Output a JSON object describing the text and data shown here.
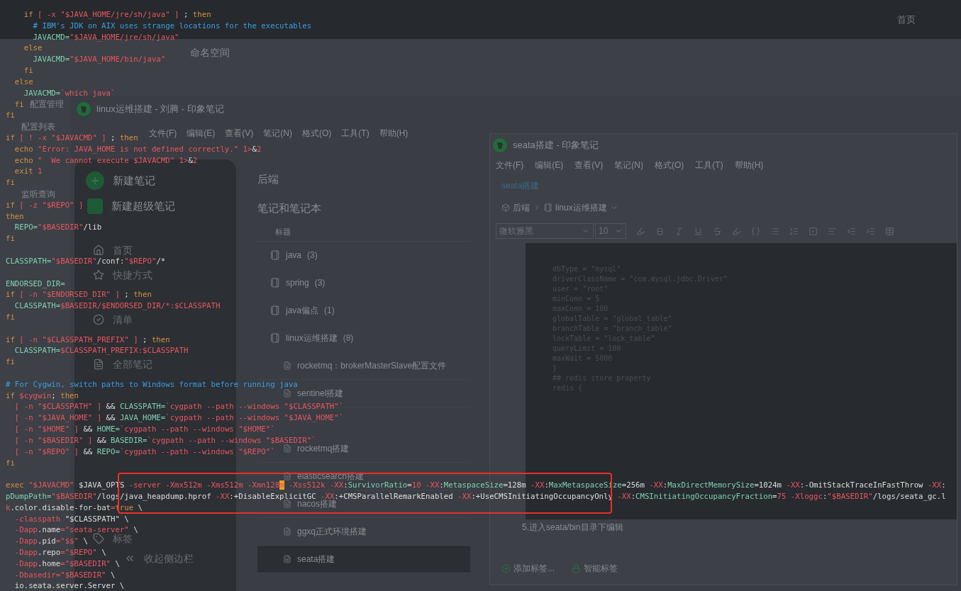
{
  "nacos": {
    "top_link": "首页",
    "namespace": "命名空间",
    "sidebar": [
      "配置管理",
      "配置列表",
      "监听查询"
    ]
  },
  "notes_window": {
    "title": "linux运维搭建 - 刘腾 - 印象笔记",
    "menu": [
      "文件(F)",
      "编辑(E)",
      "查看(V)",
      "笔记(N)",
      "格式(O)",
      "工具(T)",
      "帮助(H)"
    ],
    "actions": [
      {
        "kind": "note",
        "label": "新建笔记"
      },
      {
        "kind": "super",
        "label": "新建超级笔记"
      }
    ],
    "nav": [
      {
        "kind": "home",
        "label": "首页"
      },
      {
        "kind": "star",
        "label": "快捷方式"
      },
      {
        "kind": "check",
        "label": "清单"
      },
      {
        "kind": "notes",
        "label": "全部笔记"
      },
      {
        "kind": "tag",
        "label": "标签"
      },
      {
        "kind": "collapse",
        "label": "收起侧边栏"
      }
    ],
    "space": "后端",
    "section": "笔记和笔记本",
    "column": "标题",
    "notebooks": [
      {
        "name": "java",
        "count": "(3)"
      },
      {
        "name": "spring",
        "count": "(3)"
      },
      {
        "name": "java偏点",
        "count": "(1)"
      },
      {
        "name": "linux运维搭建",
        "count": "(8)",
        "children": [
          {
            "title": "rocketmq：brokerMasterSlave配置文件",
            "selected": false
          },
          {
            "title": "sentinel搭建",
            "selected": false
          },
          {
            "title": "rocketmq搭建",
            "selected": false
          },
          {
            "title": "elasticsearch搭建",
            "selected": false
          },
          {
            "title": "nacos搭建",
            "selected": false
          },
          {
            "title": "ggxq正式环境搭建",
            "selected": false
          },
          {
            "title": "seata搭建",
            "selected": true
          }
        ]
      }
    ]
  },
  "note_window": {
    "title": "seata搭建 - 印象笔记",
    "menu": [
      "文件(F)",
      "编辑(E)",
      "查看(V)",
      "笔记(N)",
      "格式(O)",
      "工具(T)",
      "帮助(H)"
    ],
    "note_link": "seata搭建",
    "breadcrumb": [
      "后端",
      "linux运维搭建"
    ],
    "font": "微软雅黑",
    "size": "10",
    "code": [
      "dbType = \"mysql\"",
      "driverClassName = \"com.mysql.jdbc.Driver\"",
      "user = \"root\"",
      "minConn = 5",
      "maxConn = 100",
      "globalTable = \"global_table\"",
      "branchTable = \"branch_table\"",
      "lockTable = \"lock_table\"",
      "queryLimit = 100",
      "maxWait = 5000",
      "}",
      "## redis store property",
      "redis {"
    ],
    "step": "5.进入seata/bin目录下编辑",
    "tag_buttons": [
      {
        "kind": "add",
        "label": "添加标签..."
      },
      {
        "kind": "smart",
        "label": "智能标签"
      }
    ]
  },
  "terminal": {
    "lines": [
      {
        "tokens": [
          {
            "kind": "k",
            "text": "    if"
          },
          {
            "kind": "s",
            "text": " [ -x \"$JAVA_HOME/jre/sh/java\" ]"
          },
          {
            "kind": "p",
            "text": " ; "
          },
          {
            "kind": "k",
            "text": "then"
          }
        ]
      },
      {
        "tokens": [
          {
            "kind": "c",
            "text": "      # IBM's JDK on AIX uses strange locations for the executables"
          }
        ]
      },
      {
        "tokens": [
          {
            "kind": "v",
            "text": "      JAVACMD="
          },
          {
            "kind": "s",
            "text": "\"$JAVA_HOME/jre/sh/java\""
          }
        ]
      },
      {
        "tokens": [
          {
            "kind": "k",
            "text": "    else"
          }
        ]
      },
      {
        "tokens": [
          {
            "kind": "v",
            "text": "      JAVACMD="
          },
          {
            "kind": "s",
            "text": "\"$JAVA_HOME/bin/java\""
          }
        ]
      },
      {
        "tokens": [
          {
            "kind": "k",
            "text": "    fi"
          }
        ]
      },
      {
        "tokens": [
          {
            "kind": "k",
            "text": "  else"
          }
        ]
      },
      {
        "tokens": [
          {
            "kind": "v",
            "text": "    JAVACMD="
          },
          {
            "kind": "s",
            "text": "`which java`"
          }
        ]
      },
      {
        "tokens": [
          {
            "kind": "k",
            "text": "  fi"
          }
        ]
      },
      {
        "tokens": [
          {
            "kind": "k",
            "text": "fi"
          }
        ]
      },
      {
        "kind": "blank"
      },
      {
        "tokens": [
          {
            "kind": "k",
            "text": "if"
          },
          {
            "kind": "s",
            "text": " [ ! -x \"$JAVACMD\" ]"
          },
          {
            "kind": "p",
            "text": " ; "
          },
          {
            "kind": "k",
            "text": "then"
          }
        ]
      },
      {
        "tokens": [
          {
            "kind": "k",
            "text": "  echo"
          },
          {
            "kind": "s",
            "text": " \"Error: JAVA_HOME is not defined correctly.\""
          },
          {
            "kind": "s",
            "text": " 1>"
          },
          {
            "kind": "p",
            "text": "&"
          },
          {
            "kind": "s",
            "text": "2"
          }
        ]
      },
      {
        "tokens": [
          {
            "kind": "k",
            "text": "  echo"
          },
          {
            "kind": "s",
            "text": " \"  We cannot execute $JAVACMD\""
          },
          {
            "kind": "s",
            "text": " 1>"
          },
          {
            "kind": "p",
            "text": "&"
          },
          {
            "kind": "s",
            "text": "2"
          }
        ]
      },
      {
        "tokens": [
          {
            "kind": "k",
            "text": "  exit"
          },
          {
            "kind": "s",
            "text": " 1"
          }
        ]
      },
      {
        "tokens": [
          {
            "kind": "k",
            "text": "fi"
          }
        ]
      },
      {
        "kind": "blank"
      },
      {
        "tokens": [
          {
            "kind": "k",
            "text": "if"
          },
          {
            "kind": "s",
            "text": " [ -z \"$REPO\" ]"
          }
        ]
      },
      {
        "tokens": [
          {
            "kind": "k",
            "text": "then"
          }
        ]
      },
      {
        "tokens": [
          {
            "kind": "v",
            "text": "  REPO="
          },
          {
            "kind": "s",
            "text": "\"$BASEDIR\""
          },
          {
            "kind": "p",
            "text": "/lib"
          }
        ]
      },
      {
        "tokens": [
          {
            "kind": "k",
            "text": "fi"
          }
        ]
      },
      {
        "kind": "blank"
      },
      {
        "tokens": [
          {
            "kind": "v",
            "text": "CLASSPATH="
          },
          {
            "kind": "s",
            "text": "\"$BASEDIR\""
          },
          {
            "kind": "p",
            "text": "/conf:"
          },
          {
            "kind": "s",
            "text": "\"$REPO\""
          },
          {
            "kind": "p",
            "text": "/*"
          }
        ]
      },
      {
        "kind": "blank"
      },
      {
        "tokens": [
          {
            "kind": "v",
            "text": "ENDORSED_DIR="
          }
        ]
      },
      {
        "tokens": [
          {
            "kind": "k",
            "text": "if"
          },
          {
            "kind": "s",
            "text": " [ -n \"$ENDORSED_DIR\" ]"
          },
          {
            "kind": "p",
            "text": " ; "
          },
          {
            "kind": "k",
            "text": "then"
          }
        ]
      },
      {
        "tokens": [
          {
            "kind": "v",
            "text": "  CLASSPATH="
          },
          {
            "kind": "s",
            "text": "$BASEDIR/$ENDORSED_DIR/*:$CLASSPATH"
          }
        ]
      },
      {
        "tokens": [
          {
            "kind": "k",
            "text": "fi"
          }
        ]
      },
      {
        "kind": "blank"
      },
      {
        "tokens": [
          {
            "kind": "k",
            "text": "if"
          },
          {
            "kind": "s",
            "text": " [ -n \"$CLASSPATH_PREFIX\" ]"
          },
          {
            "kind": "p",
            "text": " ; "
          },
          {
            "kind": "k",
            "text": "then"
          }
        ]
      },
      {
        "tokens": [
          {
            "kind": "v",
            "text": "  CLASSPATH="
          },
          {
            "kind": "s",
            "text": "$CLASSPATH_PREFIX:$CLASSPATH"
          }
        ]
      },
      {
        "tokens": [
          {
            "kind": "k",
            "text": "fi"
          }
        ]
      },
      {
        "kind": "blank"
      },
      {
        "tokens": [
          {
            "kind": "c",
            "text": "# For Cygwin, switch paths to Windows format before running java"
          }
        ]
      },
      {
        "tokens": [
          {
            "kind": "k",
            "text": "if"
          },
          {
            "kind": "s",
            "text": " $cygwin"
          },
          {
            "kind": "p",
            "text": "; "
          },
          {
            "kind": "k",
            "text": "then"
          }
        ]
      },
      {
        "tokens": [
          {
            "kind": "s",
            "text": "  [ -n \"$CLASSPATH\" ]"
          },
          {
            "kind": "p",
            "text": " && "
          },
          {
            "kind": "v",
            "text": "CLASSPATH="
          },
          {
            "kind": "s",
            "text": "`cygpath --path --windows \"$CLASSPATH\"`"
          }
        ]
      },
      {
        "tokens": [
          {
            "kind": "s",
            "text": "  [ -n \"$JAVA_HOME\" ]"
          },
          {
            "kind": "p",
            "text": " && "
          },
          {
            "kind": "v",
            "text": "JAVA_HOME="
          },
          {
            "kind": "s",
            "text": "`cygpath --path --windows \"$JAVA_HOME\"`"
          }
        ]
      },
      {
        "tokens": [
          {
            "kind": "s",
            "text": "  [ -n \"$HOME\" ]"
          },
          {
            "kind": "p",
            "text": " && "
          },
          {
            "kind": "v",
            "text": "HOME="
          },
          {
            "kind": "s",
            "text": "`cygpath --path --windows \"$HOME\"`"
          }
        ]
      },
      {
        "tokens": [
          {
            "kind": "s",
            "text": "  [ -n \"$BASEDIR\" ]"
          },
          {
            "kind": "p",
            "text": " && "
          },
          {
            "kind": "v",
            "text": "BASEDIR="
          },
          {
            "kind": "s",
            "text": "`cygpath --path --windows \"$BASEDIR\"`"
          }
        ]
      },
      {
        "tokens": [
          {
            "kind": "s",
            "text": "  [ -n \"$REPO\" ]"
          },
          {
            "kind": "p",
            "text": " && "
          },
          {
            "kind": "v",
            "text": "REPO="
          },
          {
            "kind": "s",
            "text": "`cygpath --path --windows \"$REPO\"`"
          }
        ]
      },
      {
        "tokens": [
          {
            "kind": "k",
            "text": "fi"
          }
        ]
      },
      {
        "kind": "blank"
      },
      {
        "tokens": [
          {
            "kind": "k",
            "text": "exec"
          },
          {
            "kind": "s",
            "text": " \"$JAVACMD\""
          },
          {
            "kind": "p",
            "text": " $JAVA_OPTS "
          },
          {
            "kind": "s",
            "text": "-server -Xmx512m -Xms512m -Xmn128"
          },
          {
            "kind": "cur",
            "text": "m"
          },
          {
            "kind": "s",
            "text": " -Xss512k -XX"
          },
          {
            "kind": "p",
            "text": ":"
          },
          {
            "kind": "v",
            "text": "SurvivorRatio"
          },
          {
            "kind": "p",
            "text": "="
          },
          {
            "kind": "s",
            "text": "10"
          },
          {
            "kind": "s",
            "text": " -XX"
          },
          {
            "kind": "p",
            "text": ":"
          },
          {
            "kind": "v",
            "text": "MetaspaceSize"
          },
          {
            "kind": "p",
            "text": "=128m"
          },
          {
            "kind": "s",
            "text": " -XX"
          },
          {
            "kind": "p",
            "text": ":"
          },
          {
            "kind": "v",
            "text": "MaxMetaspaceSize"
          },
          {
            "kind": "p",
            "text": "=256m"
          },
          {
            "kind": "s",
            "text": " -XX"
          },
          {
            "kind": "p",
            "text": ":"
          },
          {
            "kind": "v",
            "text": "MaxDirectMemorySize"
          },
          {
            "kind": "p",
            "text": "=1024m"
          },
          {
            "kind": "s",
            "text": " -XX"
          },
          {
            "kind": "p",
            "text": ":-OmitStackTraceInFastThrow"
          },
          {
            "kind": "s",
            "text": " -XX"
          },
          {
            "kind": "p",
            "text": ":"
          }
        ]
      },
      {
        "tokens": [
          {
            "kind": "v",
            "text": "pDumpPath="
          },
          {
            "kind": "s",
            "text": "\"$BASEDIR\""
          },
          {
            "kind": "p",
            "text": "/logs/java_heapdump.hprof"
          },
          {
            "kind": "s",
            "text": " -XX"
          },
          {
            "kind": "p",
            "text": ":+DisableExplicitGC"
          },
          {
            "kind": "s",
            "text": " -XX"
          },
          {
            "kind": "p",
            "text": ":+CMSParallelRemarkEnabled"
          },
          {
            "kind": "s",
            "text": " -XX"
          },
          {
            "kind": "p",
            "text": ":+UseCMSInitiatingOccupancyOnly"
          },
          {
            "kind": "s",
            "text": " -XX"
          },
          {
            "kind": "p",
            "text": ":"
          },
          {
            "kind": "v",
            "text": "CMSInitiatingOccupancyFraction"
          },
          {
            "kind": "p",
            "text": "="
          },
          {
            "kind": "s",
            "text": "75"
          },
          {
            "kind": "s",
            "text": " -Xloggc"
          },
          {
            "kind": "p",
            "text": ":"
          },
          {
            "kind": "s",
            "text": "\"$BASEDIR\""
          },
          {
            "kind": "p",
            "text": "/logs/seata_gc.l"
          }
        ]
      },
      {
        "tokens": [
          {
            "kind": "s",
            "text": "k"
          },
          {
            "kind": "p",
            "text": ".color.disable-for-bat"
          },
          {
            "kind": "s",
            "text": "="
          },
          {
            "kind": "k",
            "text": "true"
          },
          {
            "kind": "p",
            "text": " \\"
          }
        ]
      },
      {
        "tokens": [
          {
            "kind": "s",
            "text": "  -classpath"
          },
          {
            "kind": "p",
            "text": " \"$CLASSPATH\" \\"
          }
        ]
      },
      {
        "tokens": [
          {
            "kind": "s",
            "text": "  -Dapp"
          },
          {
            "kind": "p",
            "text": ".name"
          },
          {
            "kind": "s",
            "text": "=\"seata-server\""
          },
          {
            "kind": "p",
            "text": " \\"
          }
        ]
      },
      {
        "tokens": [
          {
            "kind": "s",
            "text": "  -Dapp"
          },
          {
            "kind": "p",
            "text": ".pid"
          },
          {
            "kind": "s",
            "text": "=\"$$\""
          },
          {
            "kind": "p",
            "text": " \\"
          }
        ]
      },
      {
        "tokens": [
          {
            "kind": "s",
            "text": "  -Dapp"
          },
          {
            "kind": "p",
            "text": ".repo"
          },
          {
            "kind": "s",
            "text": "=\"$REPO\""
          },
          {
            "kind": "p",
            "text": " \\"
          }
        ]
      },
      {
        "tokens": [
          {
            "kind": "s",
            "text": "  -Dapp"
          },
          {
            "kind": "p",
            "text": ".home"
          },
          {
            "kind": "s",
            "text": "=\"$BASEDIR\""
          },
          {
            "kind": "p",
            "text": " \\"
          }
        ]
      },
      {
        "tokens": [
          {
            "kind": "s",
            "text": "  -Dbasedir=\"$BASEDIR\""
          },
          {
            "kind": "p",
            "text": " \\"
          }
        ]
      },
      {
        "tokens": [
          {
            "kind": "p",
            "text": "  io.seata.server.Server \\"
          }
        ]
      }
    ]
  }
}
